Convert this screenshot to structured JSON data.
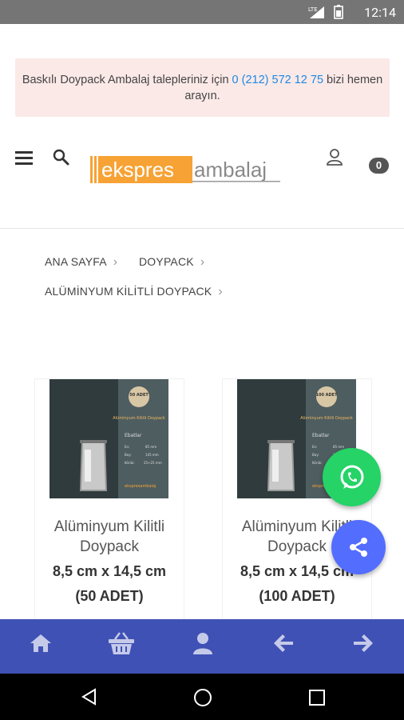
{
  "status_bar": {
    "time": "12:14",
    "network": "LTE"
  },
  "promo": {
    "text_before": "Baskılı Doypack Ambalaj talepleriniz için ",
    "phone": "0 (212) 572 12 75",
    "text_after": " bizi hemen arayın."
  },
  "header": {
    "logo_part1": "ekspres",
    "logo_part2": "ambalaj",
    "cart_count": "0"
  },
  "breadcrumb": [
    "ANA SAYFA",
    "DOYPACK",
    "ALÜMİNYUM KİLİTLİ DOYPACK"
  ],
  "products": [
    {
      "name": "Alüminyum Kilitli Doypack",
      "size": "8,5 cm x 14,5 cm",
      "qty": "(50 ADET)",
      "badge": "50 ADET"
    },
    {
      "name": "Alüminyum Kilitli Doypack",
      "size": "8,5 cm x 14,5 cm",
      "qty": "(100 ADET)",
      "badge": "100 ADET"
    }
  ],
  "image_text": {
    "title": "Alüminyum Kilitli Doypack",
    "dims_title": "Ebatlar",
    "dims": [
      {
        "k": "En:",
        "v": "85 mm"
      },
      {
        "k": "Boy:",
        "v": "145 mm"
      },
      {
        "k": "Körük:",
        "v": "25+25 mm"
      }
    ],
    "brand": "ekspresambalaj"
  },
  "colors": {
    "accent_blue": "#3f51b5",
    "whatsapp": "#25d366",
    "share": "#536dfe",
    "promo_bg": "#fbe9e7",
    "logo_orange": "#f7a234"
  }
}
